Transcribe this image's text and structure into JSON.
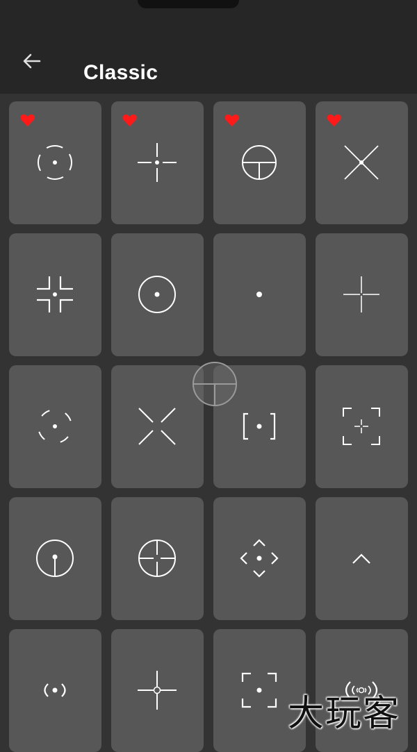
{
  "header": {
    "title": "Classic",
    "back_icon": "arrow-left-icon"
  },
  "colors": {
    "favorite": "#ff1a1a",
    "card": "#575757",
    "background": "#333333",
    "appbar": "#262626"
  },
  "crosshairs": [
    {
      "icon": "circle-dashed-crosshair-icon",
      "favorite": true
    },
    {
      "icon": "cross-gap-dot-crosshair-icon",
      "favorite": true
    },
    {
      "icon": "circle-t-crosshair-icon",
      "favorite": true
    },
    {
      "icon": "x-dot-crosshair-icon",
      "favorite": true
    },
    {
      "icon": "corner-brackets-crosshair-icon",
      "favorite": false
    },
    {
      "icon": "circle-dot-crosshair-icon",
      "favorite": false
    },
    {
      "icon": "dot-crosshair-icon",
      "favorite": false
    },
    {
      "icon": "thin-cross-crosshair-icon",
      "favorite": false
    },
    {
      "icon": "quad-arc-crosshair-icon",
      "favorite": false
    },
    {
      "icon": "x-gap-crosshair-icon",
      "favorite": false
    },
    {
      "icon": "bracket-dot-crosshair-icon",
      "favorite": false
    },
    {
      "icon": "frame-cross-crosshair-icon",
      "favorite": false
    },
    {
      "icon": "circle-stem-crosshair-icon",
      "favorite": false
    },
    {
      "icon": "circle-cross-crosshair-icon",
      "favorite": false
    },
    {
      "icon": "diamond-dot-crosshair-icon",
      "favorite": false
    },
    {
      "icon": "chevron-up-crosshair-icon",
      "favorite": false
    },
    {
      "icon": "paren-dot-crosshair-icon",
      "favorite": false
    },
    {
      "icon": "cross-ring-crosshair-icon",
      "favorite": false
    },
    {
      "icon": "frame-dot-crosshair-icon",
      "favorite": false
    },
    {
      "icon": "arc-wave-crosshair-icon",
      "favorite": false
    }
  ],
  "overlay_icon": "floating-crosshair-preview-icon",
  "watermark": "大玩客"
}
